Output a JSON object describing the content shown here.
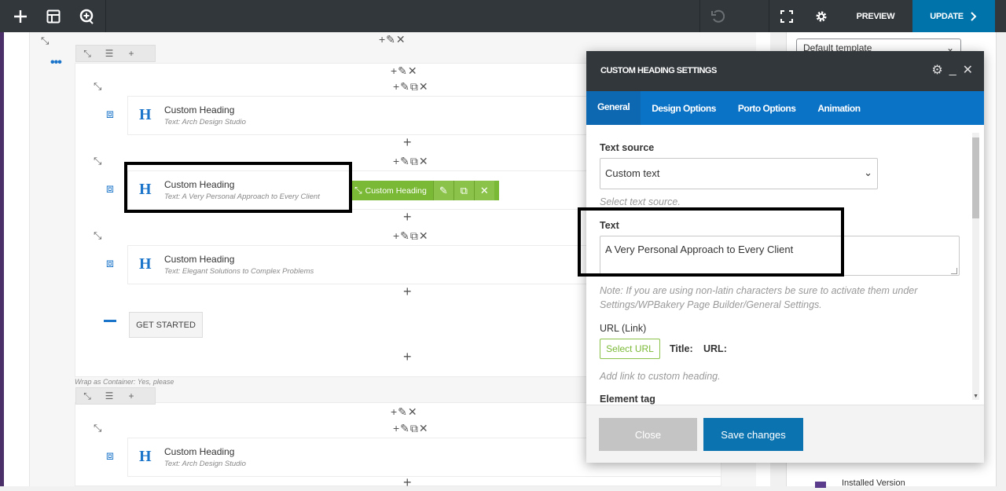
{
  "topbar": {
    "preview_label": "PREVIEW",
    "update_label": "UPDATE",
    "icons": [
      "plus-icon",
      "layout-icon",
      "search-icon",
      "undo-icon",
      "fullscreen-icon",
      "gear-icon",
      "chevron-right-icon"
    ]
  },
  "canvas": {
    "elements": [
      {
        "title": "Custom Heading",
        "subtitle": "Text: Arch Design Studio"
      },
      {
        "title": "Custom Heading",
        "subtitle": "Text: A Very Personal Approach to Every Client"
      },
      {
        "title": "Custom Heading",
        "subtitle": "Text: Elegant Solutions to Complex Problems"
      },
      {
        "title": "Custom Heading",
        "subtitle": "Text: Arch Design Studio"
      }
    ],
    "active_toolbar_label": "Custom Heading",
    "get_started_label": "GET STARTED",
    "wrap_note": "Wrap as Container: Yes, please"
  },
  "right_panel": {
    "template_select": "Default template",
    "installed_label": "Installed Version"
  },
  "modal": {
    "title": "CUSTOM HEADING SETTINGS",
    "tabs": [
      "General",
      "Design Options",
      "Porto Options",
      "Animation"
    ],
    "active_tab": "General",
    "text_source_label": "Text source",
    "text_source_value": "Custom text",
    "text_source_help": "Select text source.",
    "text_label": "Text",
    "text_value": "A Very Personal Approach to Every Client",
    "note": "Note: If you are using non-latin characters be sure to activate them under Settings/WPBakery Page Builder/General Settings.",
    "url_label": "URL (Link)",
    "select_url_label": "Select URL",
    "title_label": "Title:",
    "url_meta_label": "URL:",
    "url_help": "Add link to custom heading.",
    "element_tag_label": "Element tag",
    "close_label": "Close",
    "save_label": "Save changes"
  },
  "colors": {
    "topbar": "#32373c",
    "accent_blue": "#0073aa",
    "tabs_blue": "#0b73c6",
    "green_toolbar": "#7ab935",
    "heading_icon_blue": "#1a74c9"
  }
}
